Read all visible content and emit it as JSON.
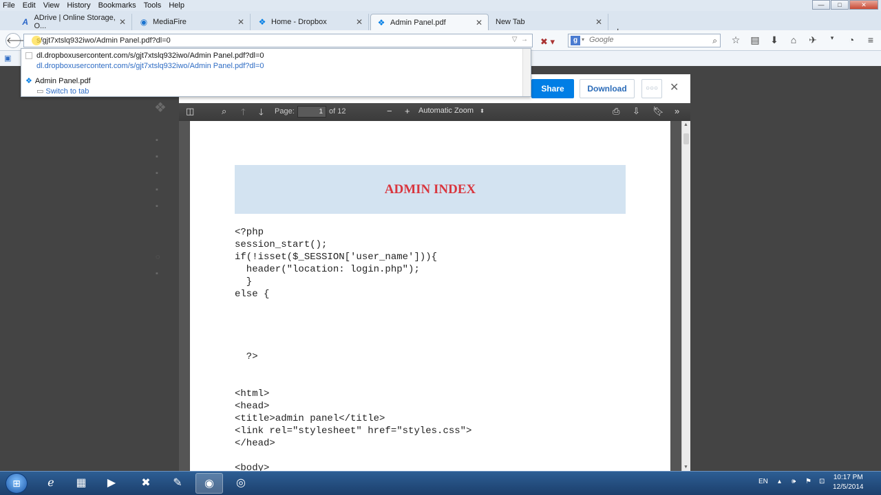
{
  "menu": [
    "File",
    "Edit",
    "View",
    "History",
    "Bookmarks",
    "Tools",
    "Help"
  ],
  "window_controls": {
    "minimize": "—",
    "maximize": "□",
    "close": "✕"
  },
  "tabs": [
    {
      "label": "ADrive | Online Storage, O...",
      "icon": "adrive-icon",
      "glyph": "A"
    },
    {
      "label": "MediaFire",
      "icon": "mediafire-icon",
      "glyph": "◉"
    },
    {
      "label": "Home - Dropbox",
      "icon": "dropbox-icon",
      "glyph": "❖"
    },
    {
      "label": "Admin Panel.pdf",
      "icon": "dropbox-icon",
      "glyph": "❖",
      "active": true
    },
    {
      "label": "New Tab",
      "icon": "",
      "glyph": ""
    }
  ],
  "address_bar": {
    "value": "s/gjt7xtslq932iwo/Admin Panel.pdf?dl=0"
  },
  "search_bar": {
    "engine": "g",
    "placeholder": "Google"
  },
  "url_dropdown": {
    "items": [
      {
        "title": "dl.dropboxusercontent.com/s/gjt7xtslq932iwo/Admin Panel.pdf?dl=0",
        "subtitle": "dl.dropboxusercontent.com/s/gjt7xtslq932iwo/Admin Panel.pdf?dl=0"
      },
      {
        "title": "Admin Panel.pdf",
        "subtitle": "Switch to tab"
      }
    ]
  },
  "dropbox": {
    "share_label": "Share",
    "download_label": "Download",
    "more_label": "○○○",
    "close_label": "✕"
  },
  "pdf_toolbar": {
    "page_label": "Page:",
    "page_value": "1",
    "page_total": "of 12",
    "zoom": "Automatic Zoom"
  },
  "pdf": {
    "banner": "ADMIN INDEX",
    "code_lines": [
      "<?php",
      "session_start();",
      "if(!isset($_SESSION['user_name'])){",
      "  header(\"location: login.php\");",
      "  }",
      "else {",
      "  ?>",
      "<html>",
      "<head>",
      "<title>admin panel</title>",
      "<link rel=\"stylesheet\" href=\"styles.css\">",
      "</head>",
      "<body>"
    ]
  },
  "tray": {
    "language": "EN",
    "time": "10:17 PM",
    "date": "12/5/2014"
  },
  "colors": {
    "dropbox_blue": "#007ee5",
    "banner_bg": "#d3e3f1",
    "banner_text": "#d9363e",
    "taskbar": "#1c3f6c"
  }
}
